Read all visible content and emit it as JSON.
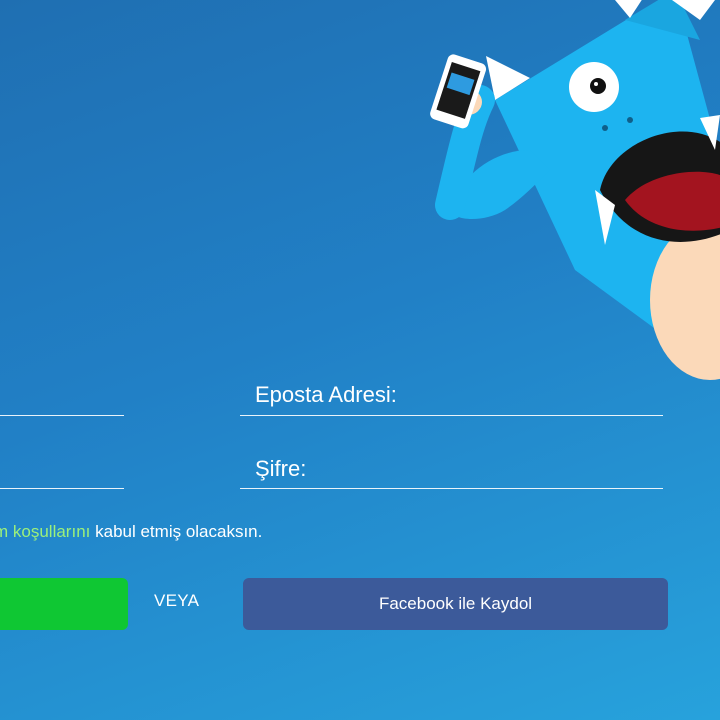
{
  "form": {
    "email_label": "Eposta Adresi:",
    "password_label": "Şifre:",
    "email_value": "",
    "password_value": ""
  },
  "terms": {
    "prefix": "m ",
    "link_text": "koşulları",
    "link_suffix": "nı",
    "rest": " kabul etmiş olacaksın."
  },
  "actions": {
    "or_label": "VEYA",
    "facebook_label": "Facebook ile Kaydol"
  },
  "colors": {
    "background": "#2180c6",
    "primary_button": "#0fc733",
    "facebook_button": "#3c5a9a",
    "link": "#9cf07a"
  },
  "illustration": {
    "name": "blue-monster-mascot-with-phone"
  }
}
